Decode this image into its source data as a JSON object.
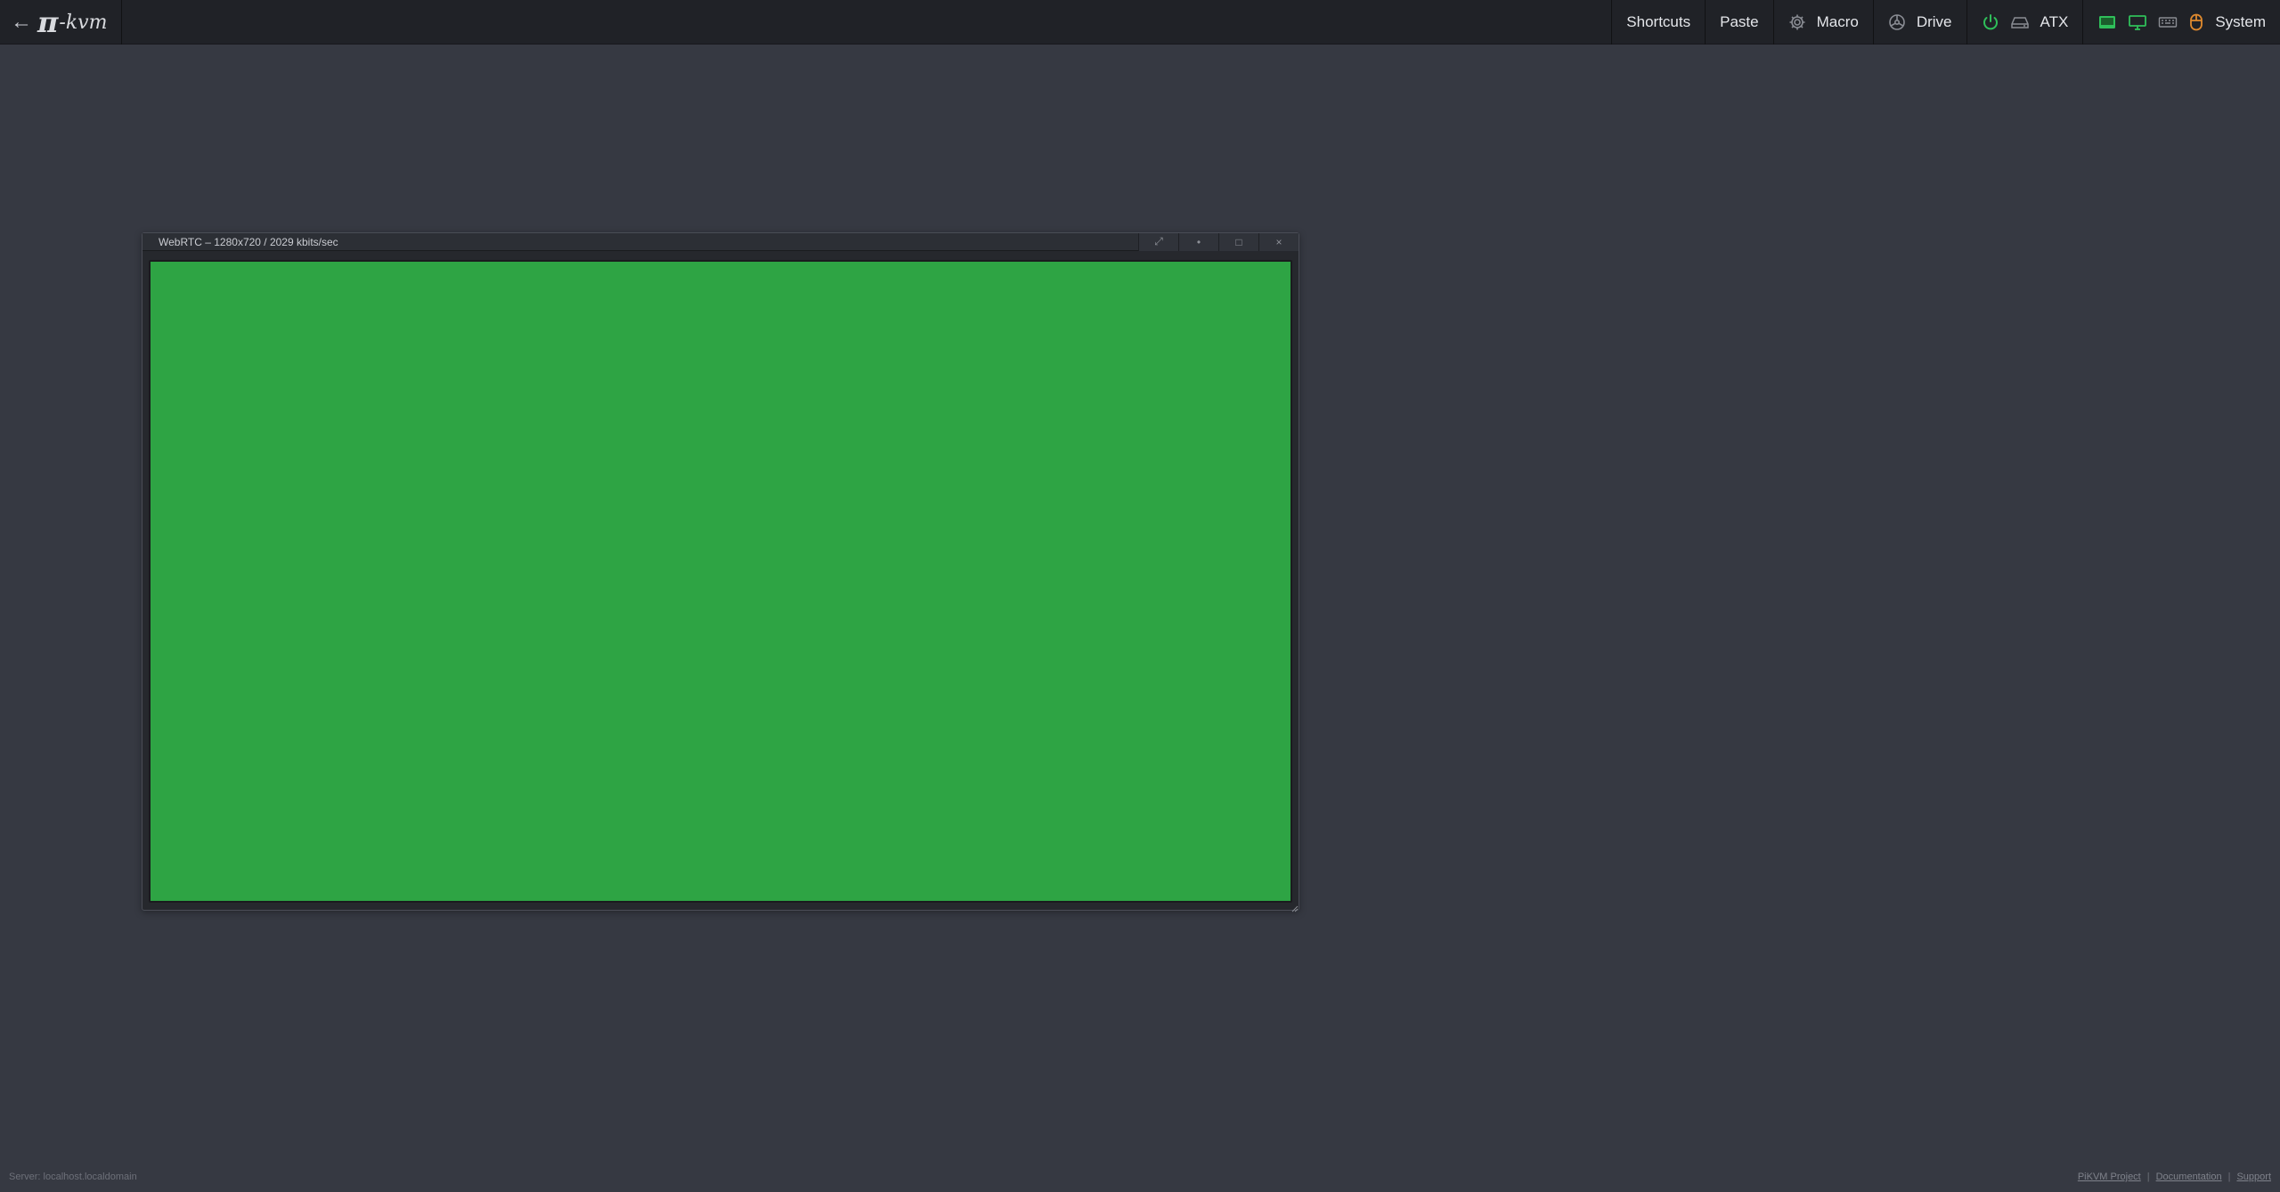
{
  "header": {
    "back_arrow": "←",
    "logo_pi": "π",
    "logo_text": "-kvm",
    "menu": {
      "shortcuts": "Shortcuts",
      "paste": "Paste",
      "macro": "Macro",
      "drive": "Drive",
      "atx": "ATX",
      "system": "System"
    },
    "colors": {
      "power_led": "#2fbf5a",
      "hid_online": "#2fbf5a",
      "mouse": "#e08a2e",
      "inactive": "#8a8d94"
    }
  },
  "stream_window": {
    "title": "WebRTC – 1280x720 / 2029 kbits/sec",
    "buttons": {
      "expand": "⤢",
      "minimize": "•",
      "maximize": "□",
      "close": "×"
    },
    "video_color": "#2ea444"
  },
  "footer": {
    "server": "Server: localhost.localdomain",
    "links": {
      "project": "PiKVM Project",
      "docs": "Documentation",
      "support": "Support"
    },
    "separator": "|"
  }
}
